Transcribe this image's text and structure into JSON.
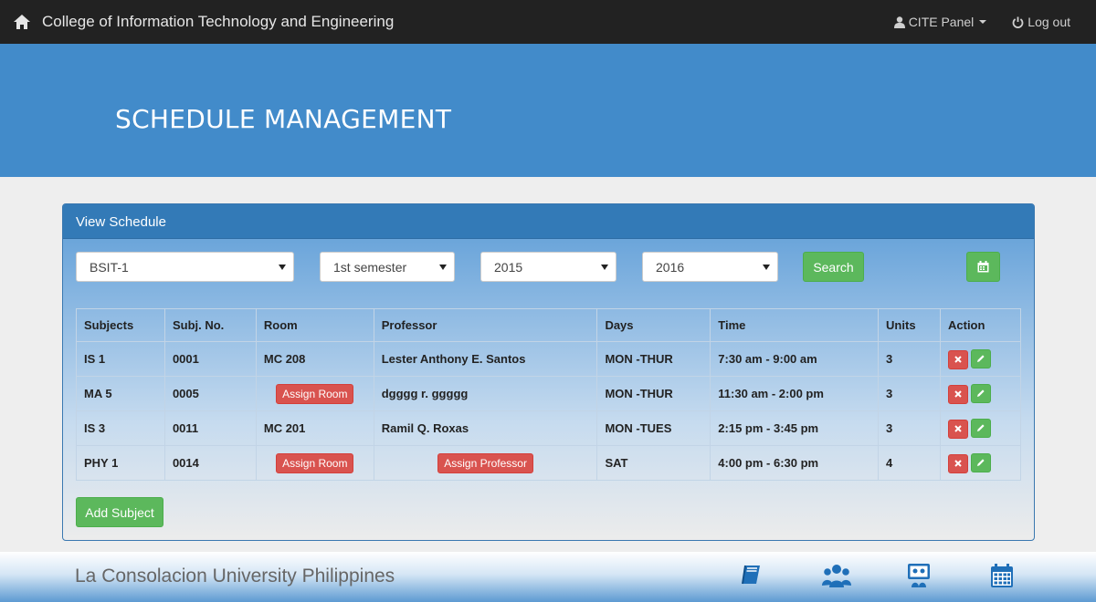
{
  "nav": {
    "brand": "College of Information Technology and Engineering",
    "panel_label": "CITE Panel",
    "logout_label": "Log out"
  },
  "hero": {
    "title": "SCHEDULE MANAGEMENT"
  },
  "panel": {
    "heading": "View Schedule",
    "filters": {
      "program": "BSIT-1",
      "semester": "1st semester",
      "year_from": "2015",
      "year_to": "2016",
      "search_label": "Search"
    },
    "table": {
      "headers": [
        "Subjects",
        "Subj. No.",
        "Room",
        "Professor",
        "Days",
        "Time",
        "Units",
        "Action"
      ],
      "rows": [
        {
          "subject": "IS 1",
          "subj_no": "0001",
          "room": "MC 208",
          "professor": "Lester Anthony E. Santos",
          "days": "MON -THUR",
          "time": "7:30 am - 9:00 am",
          "units": "3"
        },
        {
          "subject": "MA 5",
          "subj_no": "0005",
          "room": "Assign Room",
          "professor": "dgggg r. ggggg",
          "days": "MON -THUR",
          "time": "11:30 am - 2:00 pm",
          "units": "3"
        },
        {
          "subject": "IS 3",
          "subj_no": "0011",
          "room": "MC 201",
          "professor": "Ramil Q. Roxas",
          "days": "MON -TUES",
          "time": "2:15 pm - 3:45 pm",
          "units": "3"
        },
        {
          "subject": "PHY 1",
          "subj_no": "0014",
          "room": "Assign Room",
          "professor": "Assign Professor",
          "days": "SAT",
          "time": "4:00 pm - 6:30 pm",
          "units": "4"
        }
      ]
    },
    "add_subject_label": "Add Subject"
  },
  "footer": {
    "title": "La Consolacion University Philippines"
  },
  "icons": {
    "home": "home-icon",
    "user": "user-icon",
    "power": "power-icon",
    "calendar": "calendar-icon",
    "delete": "remove-icon",
    "edit": "pencil-icon",
    "book": "book-icon",
    "users": "users-icon",
    "classroom": "classroom-icon"
  },
  "colors": {
    "navbar": "#222222",
    "hero": "#428bca",
    "panel_heading": "#337ab7",
    "success": "#5cb85c",
    "danger": "#d9534f"
  }
}
